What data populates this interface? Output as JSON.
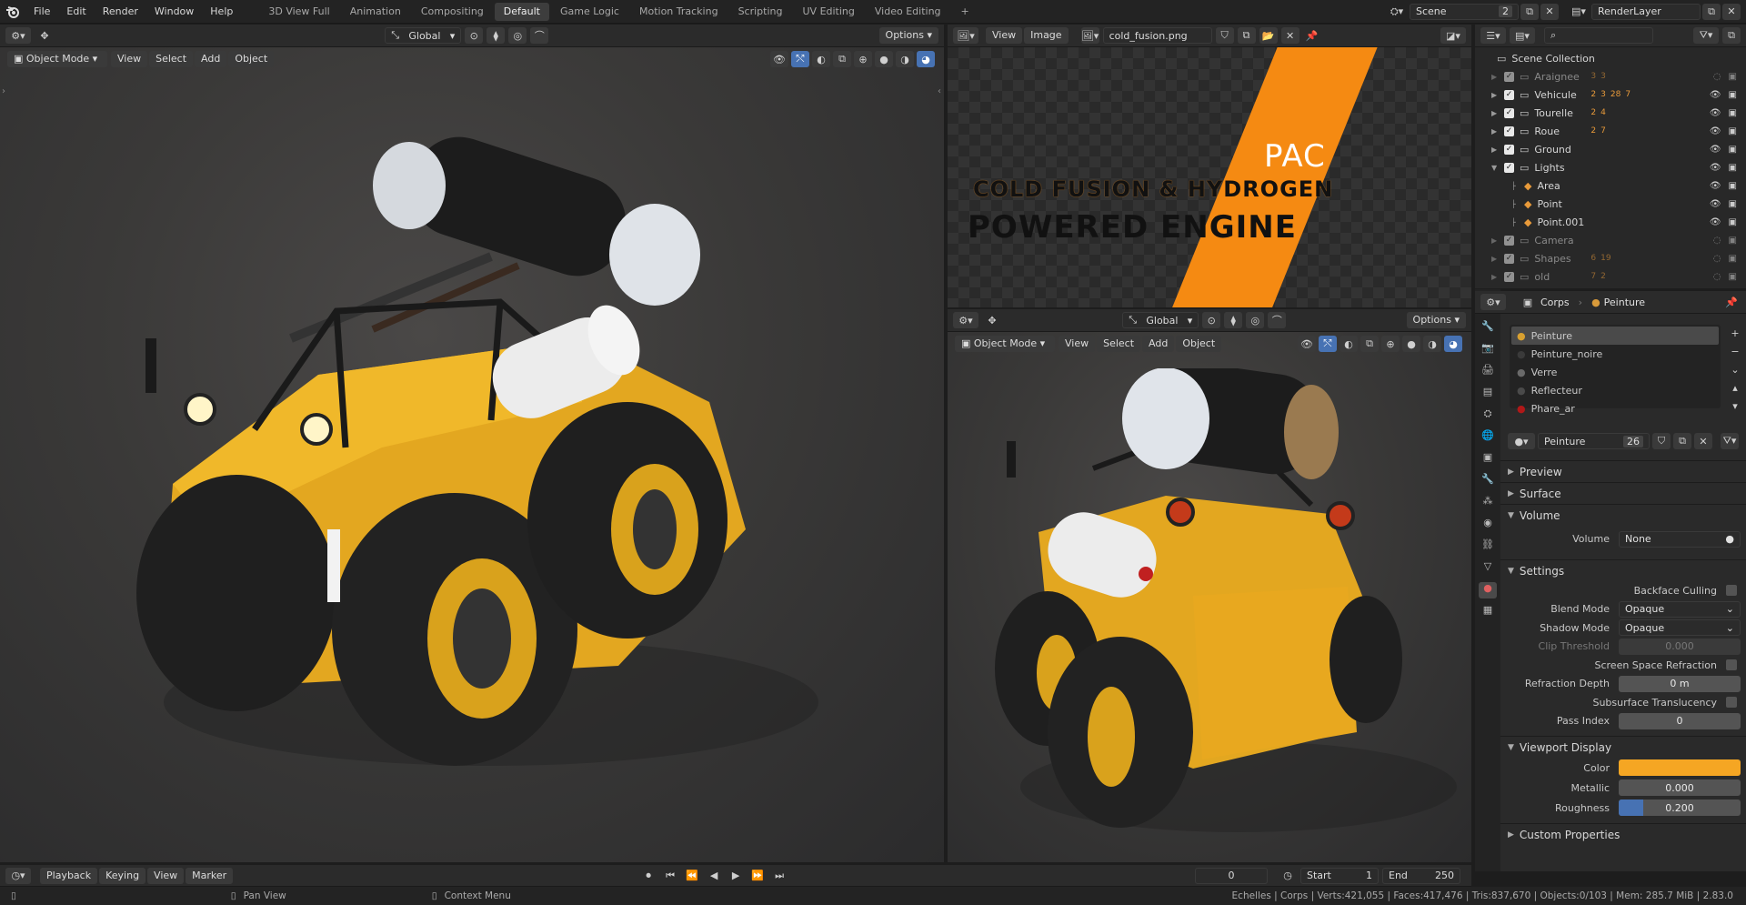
{
  "topbar": {
    "menus": [
      "File",
      "Edit",
      "Render",
      "Window",
      "Help"
    ],
    "workspaces": [
      "3D View Full",
      "Animation",
      "Compositing",
      "Default",
      "Game Logic",
      "Motion Tracking",
      "Scripting",
      "UV Editing",
      "Video Editing"
    ],
    "active_workspace": "Default",
    "add_workspace": "+",
    "scene_label": "Scene",
    "scene_count": "2",
    "render_layer": "RenderLayer"
  },
  "viewport_left": {
    "orientation": "Global",
    "options": "Options",
    "mode": "Object Mode",
    "menus": [
      "View",
      "Select",
      "Add",
      "Object"
    ]
  },
  "image_editor": {
    "menus": [
      "View",
      "Image"
    ],
    "image_name": "cold_fusion.png",
    "image_text": {
      "brand": "PAC",
      "line1": "COLD FUSION & HYDROGEN",
      "line2": "POWERED ENGINE"
    }
  },
  "viewport_right": {
    "orientation": "Global",
    "options": "Options",
    "mode": "Object Mode",
    "menus": [
      "View",
      "Select",
      "Add",
      "Object"
    ]
  },
  "outliner": {
    "root": "Scene Collection",
    "items": [
      {
        "name": "Araignee",
        "badges": [
          "3",
          "3"
        ],
        "dim": true
      },
      {
        "name": "Vehicule",
        "badges": [
          "2",
          "3",
          "28",
          "7"
        ],
        "dim": false
      },
      {
        "name": "Tourelle",
        "badges": [
          "2",
          "4"
        ],
        "dim": false
      },
      {
        "name": "Roue",
        "badges": [
          "2",
          "7"
        ],
        "dim": false
      },
      {
        "name": "Ground",
        "badges": [],
        "dim": false
      },
      {
        "name": "Lights",
        "badges": [],
        "dim": false,
        "expanded": true
      },
      {
        "name": "Area",
        "badges": [],
        "dim": false,
        "child": true
      },
      {
        "name": "Point",
        "badges": [],
        "dim": false,
        "child": true
      },
      {
        "name": "Point.001",
        "badges": [],
        "dim": false,
        "child": true
      },
      {
        "name": "Camera",
        "badges": [],
        "dim": true
      },
      {
        "name": "Shapes",
        "badges": [
          "6",
          "19"
        ],
        "dim": true
      },
      {
        "name": "old",
        "badges": [
          "7",
          "2"
        ],
        "dim": true
      }
    ]
  },
  "properties": {
    "object_name": "Corps",
    "material_name": "Peinture",
    "slots": [
      "Peinture",
      "Peinture_noire",
      "Verre",
      "Reflecteur",
      "Phare_ar"
    ],
    "slot_colors": [
      "#d8a030",
      "#3a3a3a",
      "#6a6a6a",
      "#4a4a4a",
      "#b01818"
    ],
    "active_slot": "Peinture",
    "material_users": "26",
    "sections": {
      "preview": "Preview",
      "surface": "Surface",
      "volume": "Volume",
      "settings": "Settings",
      "viewport": "Viewport Display",
      "custom": "Custom Properties"
    },
    "volume": {
      "label": "Volume",
      "value": "None"
    },
    "settings": [
      {
        "label": "Backface Culling",
        "type": "check"
      },
      {
        "label": "Blend Mode",
        "type": "drop",
        "value": "Opaque"
      },
      {
        "label": "Shadow Mode",
        "type": "drop",
        "value": "Opaque"
      },
      {
        "label": "Clip Threshold",
        "type": "num",
        "value": "0.000",
        "dim": true
      },
      {
        "label": "Screen Space Refraction",
        "type": "check"
      },
      {
        "label": "Refraction Depth",
        "type": "num",
        "value": "0 m"
      },
      {
        "label": "Subsurface Translucency",
        "type": "check"
      },
      {
        "label": "Pass Index",
        "type": "num",
        "value": "0"
      }
    ],
    "viewport_display": {
      "color_label": "Color",
      "color": "#f5a623",
      "metallic_label": "Metallic",
      "metallic": "0.000",
      "roughness_label": "Roughness",
      "roughness": "0.200",
      "roughness_fill": 0.2
    }
  },
  "timeline": {
    "menus": [
      "Playback",
      "Keying",
      "View",
      "Marker"
    ],
    "current_frame": "0",
    "start_label": "Start",
    "start": "1",
    "end_label": "End",
    "end": "250"
  },
  "statusbar": {
    "hint1": "Pan View",
    "hint2": "Context Menu",
    "stats": "Echelles | Corps | Verts:421,055 | Faces:417,476 | Tris:837,670 | Objects:0/103 | Mem: 285.7 MiB | 2.83.0"
  }
}
